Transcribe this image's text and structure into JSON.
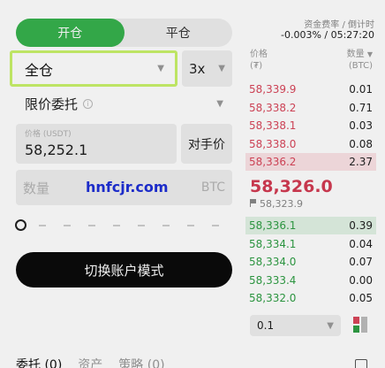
{
  "trade_tabs": {
    "open": "开仓",
    "close": "平仓"
  },
  "margin_mode": {
    "value": "全仓"
  },
  "leverage": {
    "value": "3x"
  },
  "order_type": {
    "value": "限价委托"
  },
  "price_input": {
    "label": "价格 (USDT)",
    "value": "58,252.1"
  },
  "counterparty_button": "对手价",
  "quantity_input": {
    "placeholder": "数量",
    "unit": "BTC"
  },
  "watermark": "hnfcjr.com",
  "slider": {
    "level_percent": 0
  },
  "switch_account_button": "切换账户模式",
  "funding": {
    "label": "资金费率 / 倒计时",
    "value": "-0.003% / 05:27:20"
  },
  "orderbook": {
    "price_header": "价格",
    "price_unit": "(₮)",
    "qty_header": "数量",
    "qty_unit": "(BTC)",
    "asks": [
      {
        "price": "58,339.9",
        "qty": "0.01"
      },
      {
        "price": "58,338.2",
        "qty": "0.71"
      },
      {
        "price": "58,338.1",
        "qty": "0.03"
      },
      {
        "price": "58,338.0",
        "qty": "0.08"
      },
      {
        "price": "58,336.2",
        "qty": "2.37"
      }
    ],
    "last_price": "58,326.0",
    "mark_price": "58,323.9",
    "bids": [
      {
        "price": "58,336.1",
        "qty": "0.39"
      },
      {
        "price": "58,334.1",
        "qty": "0.04"
      },
      {
        "price": "58,334.0",
        "qty": "0.07"
      },
      {
        "price": "58,333.4",
        "qty": "0.00"
      },
      {
        "price": "58,332.0",
        "qty": "0.05"
      }
    ],
    "depth_select": "0.1"
  },
  "bottom_tabs": {
    "orders": "委托 (0)",
    "assets": "资产",
    "strategy": "策略 (0)"
  },
  "colors": {
    "accent_green": "#37b24d",
    "ask_red": "#d9475b",
    "bid_green": "#2f9e44",
    "highlight": "#c9f36b"
  }
}
